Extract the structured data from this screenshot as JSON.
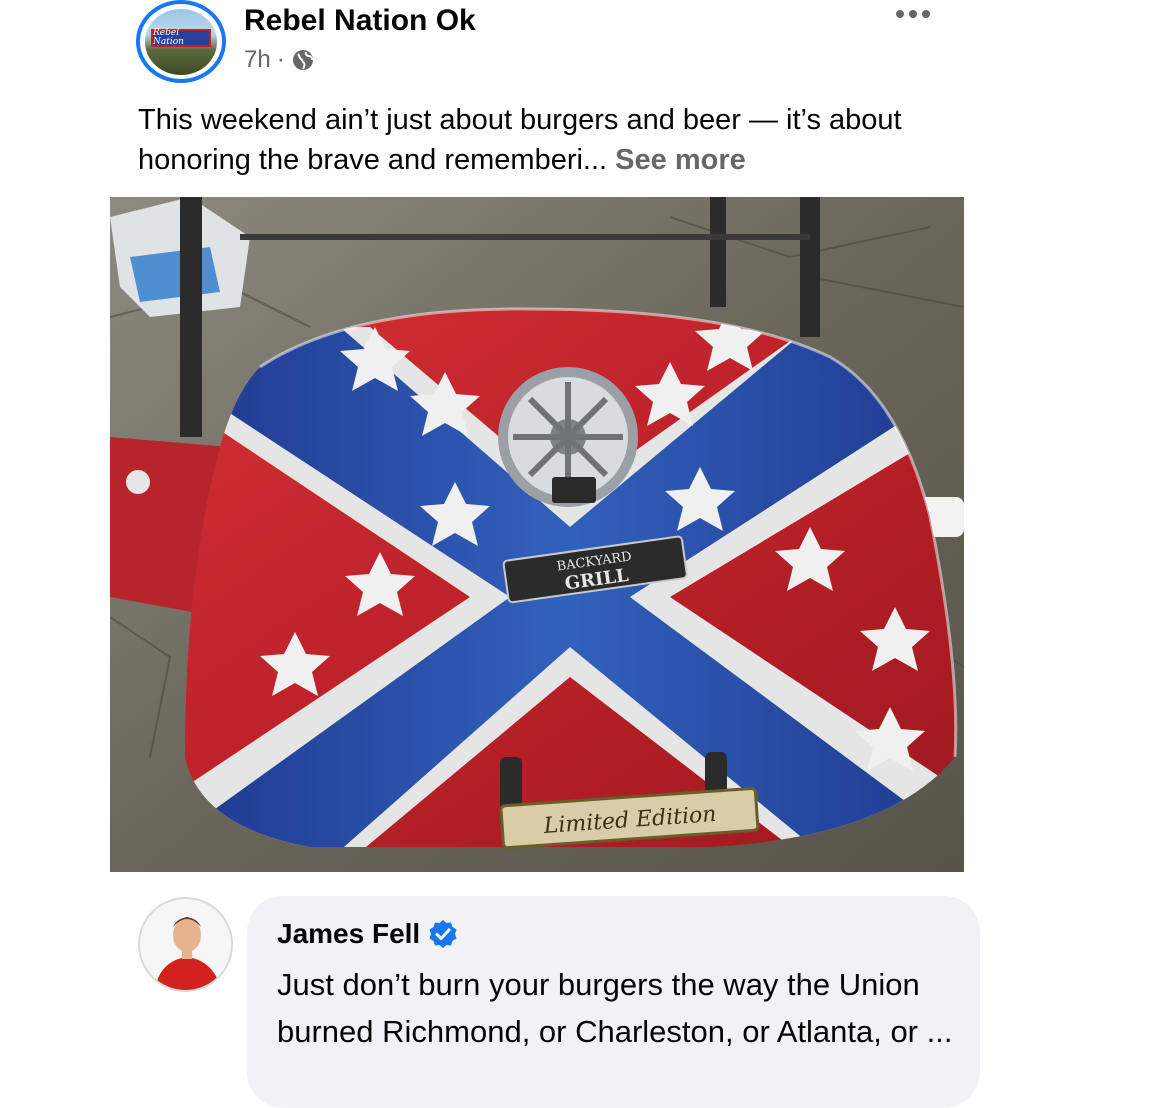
{
  "post": {
    "page_name": "Rebel Nation Ok",
    "time": "7h",
    "separator": "·",
    "audience_icon": "globe-icon",
    "avatar_sign_text": "Rebel Nation",
    "text": "This weekend ain’t just about burgers and beer — it’s about honoring the brave and rememberi... ",
    "see_more": "See more",
    "image": {
      "badge_line1": "BACKYARD",
      "badge_line2": "GRILL",
      "plate_text": "Limited Edition"
    }
  },
  "comment": {
    "author": "James Fell",
    "verified_icon": "verified-badge-icon",
    "text": "Just don’t burn your burgers the way the Union burned Richmond, or Charleston, or Atlanta, or ..."
  },
  "colors": {
    "accent": "#1877f2",
    "secondary_text": "#65676b",
    "bubble_bg": "#f0f2f5",
    "flag_red": "#c8232b",
    "flag_blue": "#2a56b8"
  }
}
